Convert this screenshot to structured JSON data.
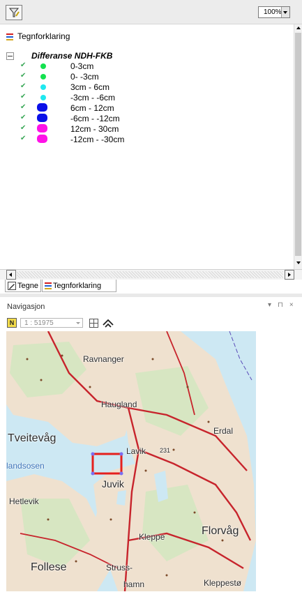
{
  "toolbar": {
    "draw_tool_icon": "draw-tool-icon",
    "zoom_value": "100%"
  },
  "legend": {
    "header_label": "Tegnforklaring",
    "group_title": "Differanse NDH-FKB",
    "items": [
      {
        "label": "0-3cm",
        "color": "#14e14f",
        "shape": "dot"
      },
      {
        "label": "0- -3cm",
        "color": "#14e14f",
        "shape": "dot"
      },
      {
        "label": "3cm - 6cm",
        "color": "#1fe8ef",
        "shape": "dot"
      },
      {
        "label": "-3cm - -6cm",
        "color": "#1fe8ef",
        "shape": "dot"
      },
      {
        "label": "6cm - 12cm",
        "color": "#0b10e8",
        "shape": "blob"
      },
      {
        "label": "-6cm - -12cm",
        "color": "#0b10e8",
        "shape": "blob"
      },
      {
        "label": "12cm - 30cm",
        "color": "#ff12e7",
        "shape": "blob"
      },
      {
        "label": "-12cm - -30cm",
        "color": "#ff12e7",
        "shape": "blob"
      }
    ]
  },
  "tabs": {
    "draw": "Tegne",
    "legend": "Tegnforklaring"
  },
  "navigation": {
    "title": "Navigasjon",
    "pin_glyph": "▾",
    "dock_glyph": "⊓",
    "close_glyph": "×",
    "n_button": "N",
    "scale_value": "1 : 51975"
  },
  "map": {
    "labels": {
      "ravnanger": "Ravnanger",
      "haugland": "Haugland",
      "tveitevag": "Tveitevåg",
      "erdal": "Erdal",
      "lavik": "Lavik",
      "road_231": "231",
      "landsosen": "landsosen",
      "juvik": "Juvik",
      "hetlevik": "Hetlevik",
      "kleppe": "Kleppe",
      "florvag": "Florvåg",
      "follese": "Follese",
      "struss": "Struss-",
      "hamn": "hamn",
      "kleppesto": "Kleppestø"
    },
    "colors": {
      "water": "#cde8f3",
      "land": "#efe1cf",
      "forest": "#d7e6c2",
      "road": "#c7242c",
      "view_box": "#e5201d"
    }
  }
}
